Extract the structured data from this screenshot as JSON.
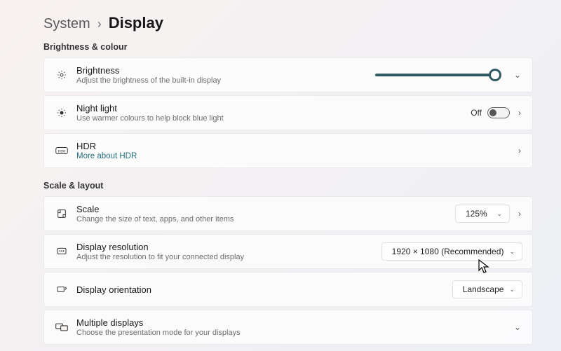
{
  "breadcrumb": {
    "parent": "System",
    "current": "Display"
  },
  "sections": {
    "brightness_colour": {
      "title": "Brightness & colour",
      "brightness": {
        "title": "Brightness",
        "subtitle": "Adjust the brightness of the built-in display"
      },
      "night_light": {
        "title": "Night light",
        "subtitle": "Use warmer colours to help block blue light",
        "state_label": "Off"
      },
      "hdr": {
        "title": "HDR",
        "link": "More about HDR"
      }
    },
    "scale_layout": {
      "title": "Scale & layout",
      "scale": {
        "title": "Scale",
        "subtitle": "Change the size of text, apps, and other items",
        "value": "125%"
      },
      "resolution": {
        "title": "Display resolution",
        "subtitle": "Adjust the resolution to fit your connected display",
        "value": "1920 × 1080 (Recommended)"
      },
      "orientation": {
        "title": "Display orientation",
        "value": "Landscape"
      },
      "multiple": {
        "title": "Multiple displays",
        "subtitle": "Choose the presentation mode for your displays"
      }
    }
  }
}
